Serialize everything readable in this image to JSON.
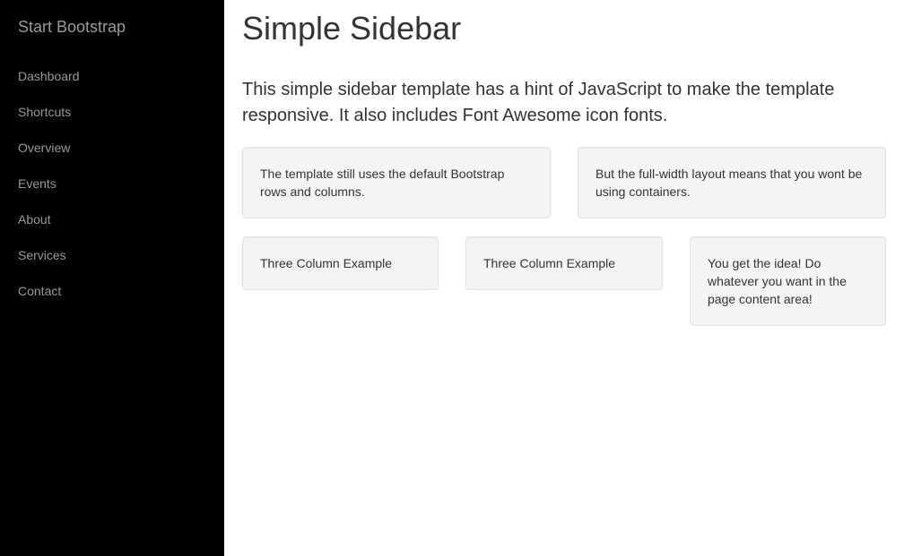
{
  "sidebar": {
    "brand": "Start Bootstrap",
    "items": [
      {
        "label": "Dashboard"
      },
      {
        "label": "Shortcuts"
      },
      {
        "label": "Overview"
      },
      {
        "label": "Events"
      },
      {
        "label": "About"
      },
      {
        "label": "Services"
      },
      {
        "label": "Contact"
      }
    ]
  },
  "main": {
    "title": "Simple Sidebar",
    "lead": "This simple sidebar template has a hint of JavaScript to make the template responsive. It also includes Font Awesome icon fonts.",
    "wells": [
      {
        "text": "The template still uses the default Bootstrap rows and columns."
      },
      {
        "text": "But the full-width layout means that you wont be using containers."
      },
      {
        "text": "Three Column Example"
      },
      {
        "text": "Three Column Example"
      },
      {
        "text": "You get the idea! Do whatever you want in the page content area!"
      }
    ]
  },
  "colors": {
    "sidebar_bg": "#000000",
    "sidebar_text": "#999999",
    "well_bg": "#f4f4f4",
    "well_border": "#e3e3e3",
    "text": "#333333"
  }
}
